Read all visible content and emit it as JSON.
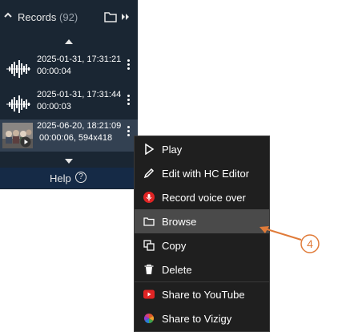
{
  "header": {
    "title": "Records",
    "count": "(92)"
  },
  "records": [
    {
      "date": "2025-01-31, 17:31:21",
      "meta": "00:00:04"
    },
    {
      "date": "2025-01-31, 17:31:44",
      "meta": "00:00:03"
    },
    {
      "date": "2025-06-20, 18:21:09",
      "meta": "00:00:06, 594x418"
    }
  ],
  "help": {
    "label": "Help",
    "icon": "?"
  },
  "menu": {
    "play": "Play",
    "edit": "Edit with HC Editor",
    "record_voice": "Record voice over",
    "browse": "Browse",
    "copy": "Copy",
    "delete": "Delete",
    "share_youtube": "Share to YouTube",
    "share_vizigy": "Share to Vizigy"
  },
  "callout": {
    "number": "4"
  },
  "colors": {
    "panel": "#1a2633",
    "help_bar": "#152a46",
    "menu_bg": "#1f1f1f",
    "highlight": "#4a4a4a",
    "callout": "#e07b39",
    "youtube": "#e02424"
  }
}
